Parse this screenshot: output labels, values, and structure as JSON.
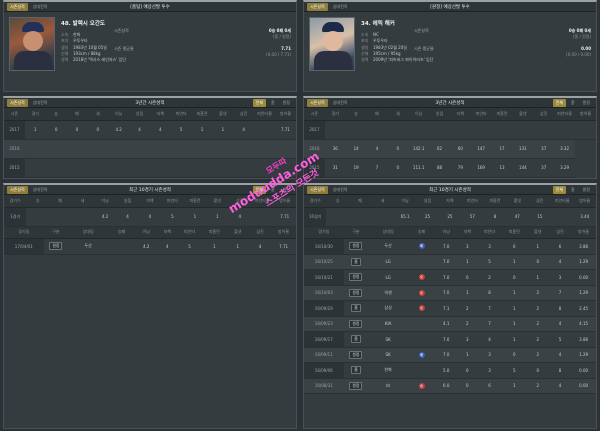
{
  "left": {
    "profile": {
      "tabs": [
        "시즌성적",
        "상대전적"
      ],
      "title": "[홈팀] 예상선발 투수",
      "name": "48. 발렉시 오간도",
      "rows": [
        [
          "소속",
          "한화"
        ],
        [
          "포지",
          "우투우타"
        ],
        [
          "생일",
          "1983년 10월 05일"
        ],
        [
          "신체",
          "193cm / 88kg"
        ],
        [
          "경력",
          "2018년 '텍사스 레인저스' 입단"
        ]
      ],
      "stats": [
        [
          "시즌성적",
          "0승 0패 0세"
        ],
        [
          "",
          "(홈 / 원정)"
        ],
        [
          "시즌 평균율",
          "7.71"
        ],
        [
          "",
          "(0.00 / 7.71)"
        ]
      ]
    },
    "season": {
      "tabs": [
        "시즌성적",
        "상대전적"
      ],
      "title": "3년간 시즌성적",
      "seg": [
        "전체",
        "홈",
        "원정"
      ],
      "headers": [
        "시즌",
        "경기",
        "승",
        "패",
        "세",
        "이닝",
        "실점",
        "자책",
        "피안타",
        "피홈런",
        "볼넷",
        "삼진",
        "피안타율",
        "방어율"
      ],
      "rows": [
        [
          "2017",
          "1",
          "0",
          "0",
          "0",
          "4.2",
          "4",
          "4",
          "5",
          "1",
          "1",
          "4",
          "",
          "7.71"
        ],
        [
          "2016",
          "",
          "",
          "",
          "",
          "",
          "",
          "",
          "",
          "",
          "",
          "",
          "",
          ""
        ],
        [
          "2015",
          "",
          "",
          "",
          "",
          "",
          "",
          "",
          "",
          "",
          "",
          "",
          "",
          ""
        ]
      ]
    },
    "recent": {
      "tabs": [
        "시즌성적",
        "상대전적"
      ],
      "title": "최근 10경기 시즌성적",
      "seg": [
        "전체",
        "홈",
        "원정"
      ],
      "headers": [
        "경기수",
        "승",
        "패",
        "세",
        "이닝",
        "실점",
        "자책",
        "피안타",
        "피홈런",
        "볼넷",
        "삼진",
        "피안타율",
        "방어율"
      ],
      "summary": [
        "1경기",
        "",
        "",
        "",
        "4.2",
        "4",
        "4",
        "5",
        "1",
        "1",
        "4",
        "",
        "7.71"
      ],
      "headers2": [
        "경기일",
        "구분",
        "상대팀",
        "승패",
        "이닝",
        "자책",
        "피안타",
        "피홈런",
        "볼넷",
        "삼진",
        "방어율"
      ],
      "rows": [
        [
          "17/04/01",
          "원정",
          "두산",
          "",
          "4.2",
          "4",
          "5",
          "1",
          "1",
          "4",
          "7.71"
        ]
      ]
    }
  },
  "right": {
    "profile": {
      "tabs": [
        "시즌성적",
        "상대전적"
      ],
      "title": "[원정] 예상선발 투수",
      "name": "34. 에릭 해커",
      "rows": [
        [
          "소속",
          "NC"
        ],
        [
          "포지",
          "우투우타"
        ],
        [
          "생일",
          "1983년 02월 20일"
        ],
        [
          "신체",
          "195cm / 95kg"
        ],
        [
          "경력",
          "2009년 '피츠버그 파이어러츠' 입단"
        ]
      ],
      "stats": [
        [
          "시즌성적",
          "0승 0패 0세"
        ],
        [
          "",
          "(홈 / 원정)"
        ],
        [
          "시즌 평균율",
          "0.00"
        ],
        [
          "",
          "(0.00 / 0.00)"
        ]
      ]
    },
    "season": {
      "tabs": [
        "시즌성적",
        "상대전적"
      ],
      "title": "3년간 시즌성적",
      "seg": [
        "전체",
        "홈",
        "원정"
      ],
      "headers": [
        "시즌",
        "경기",
        "승",
        "패",
        "세",
        "이닝",
        "실점",
        "자책",
        "피안타",
        "피홈런",
        "볼넷",
        "삼진",
        "피안타율",
        "방어율"
      ],
      "rows": [
        [
          "2017",
          "",
          "",
          "",
          "",
          "",
          "",
          "",
          "",
          "",
          "",
          "",
          "",
          ""
        ],
        [
          "2016",
          "36",
          "14",
          "4",
          "0",
          "142.1",
          "62",
          "60",
          "147",
          "17",
          "131",
          "37",
          "3.32"
        ],
        [
          "2015",
          "31",
          "19",
          "7",
          "0",
          "111.1",
          "88",
          "79",
          "169",
          "13",
          "144",
          "37",
          "3.29"
        ]
      ]
    },
    "recent": {
      "tabs": [
        "시즌성적",
        "상대전적"
      ],
      "title": "최근 10경기 시즌성적",
      "seg": [
        "전체",
        "홈",
        "원정"
      ],
      "headers": [
        "경기수",
        "승",
        "패",
        "세",
        "이닝",
        "실점",
        "자책",
        "피안타",
        "피홈런",
        "볼넷",
        "삼진",
        "피안타율",
        "방어율"
      ],
      "summary": [
        "10경기",
        "",
        "",
        "",
        "65.1",
        "25",
        "25",
        "57",
        "8",
        "47",
        "15",
        "",
        "3.44"
      ],
      "headers2": [
        "경기일",
        "구분",
        "상대팀",
        "승패",
        "이닝",
        "자책",
        "피안타",
        "피홈런",
        "볼넷",
        "삼진",
        "방어율"
      ],
      "rows": [
        [
          "16/10/30",
          "원정",
          "두산",
          "패",
          "7.0",
          "3",
          "3",
          "6",
          "1",
          "6",
          "3.86"
        ],
        [
          "16/10/25",
          "홈",
          "LG",
          "",
          "7.0",
          "1",
          "5",
          "1",
          "0",
          "4",
          "1.29"
        ],
        [
          "16/10/21",
          "원정",
          "LG",
          "승",
          "7.0",
          "0",
          "2",
          "0",
          "1",
          "3",
          "0.00"
        ],
        [
          "16/10/03",
          "원정",
          "넥센",
          "승",
          "7.0",
          "1",
          "8",
          "1",
          "2",
          "7",
          "1.29"
        ],
        [
          "16/09/29",
          "홈",
          "삼성",
          "승",
          "7.1",
          "2",
          "7",
          "1",
          "2",
          "8",
          "2.45"
        ],
        [
          "16/09/23",
          "원정",
          "KIA",
          "",
          "4.1",
          "2",
          "7",
          "1",
          "2",
          "4",
          "4.15"
        ],
        [
          "16/09/17",
          "홈",
          "SK",
          "",
          "7.0",
          "3",
          "4",
          "1",
          "2",
          "5",
          "3.86"
        ],
        [
          "16/09/11",
          "원정",
          "SK",
          "패",
          "7.0",
          "1",
          "3",
          "0",
          "2",
          "4",
          "1.29"
        ],
        [
          "16/09/06",
          "홈",
          "한화",
          "",
          "5.0",
          "0",
          "3",
          "5",
          "0",
          "8",
          "0.00"
        ],
        [
          "16/08/31",
          "원정",
          "kt",
          "승",
          "6.0",
          "0",
          "6",
          "1",
          "2",
          "4",
          "0.00"
        ]
      ]
    }
  },
  "watermark": {
    "line1": "모두따",
    "line2": "moduudda.com",
    "line3": "스포츠의 모든것"
  },
  "colors": {
    "win": "#c23a3a",
    "loss": "#3d5bb8",
    "accent": "#9a8a3c"
  }
}
